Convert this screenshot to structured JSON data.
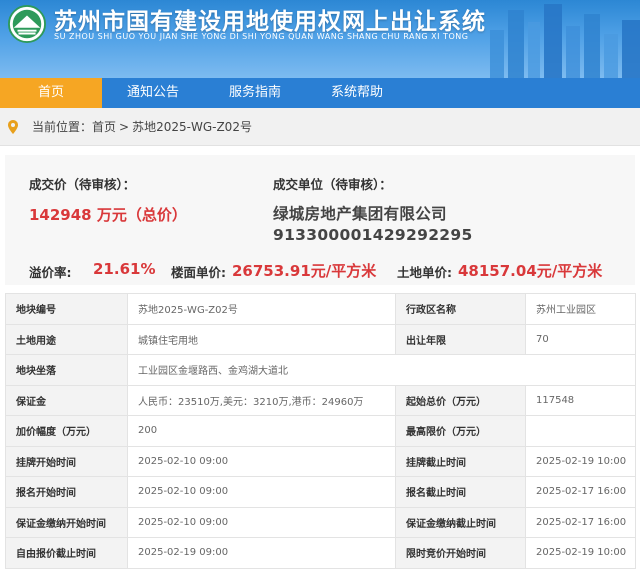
{
  "header": {
    "title": "苏州市国有建设用地使用权网上出让系统",
    "subtitle": "SU ZHOU SHI GUO YOU JIAN SHE YONG DI SHI YONG QUAN WANG SHANG CHU RANG XI TONG",
    "logo_icon": "land-emblem-icon"
  },
  "nav": {
    "items": [
      {
        "label": "首页",
        "active": true
      },
      {
        "label": "通知公告",
        "active": false
      },
      {
        "label": "服务指南",
        "active": false
      },
      {
        "label": "系统帮助",
        "active": false
      }
    ],
    "active_color": "#f6a623",
    "bar_color": "#2a7fd4"
  },
  "breadcrumb": {
    "icon": "location-pin-icon",
    "prefix": "当前位置：",
    "home": "首页",
    "separator": ">",
    "current": "苏地2025-WG-Z02号"
  },
  "summary": {
    "price_label": "成交价（待审核）：",
    "price_value": "142948 万元（总价）",
    "buyer_label": "成交单位（待审核）：",
    "buyer_name": "绿城房地产集团有限公司",
    "buyer_code": "913300001429292295",
    "premium_label": "溢价率:",
    "premium_value": "21.61%",
    "floor_price_label": "楼面单价:",
    "floor_price_value": "26753.91元/平方米",
    "land_price_label": "土地单价:",
    "land_price_value": "48157.04元/平方米",
    "highlight_color": "#d9383a"
  },
  "details": {
    "parcel_no_label": "地块编号",
    "parcel_no": "苏地2025-WG-Z02号",
    "district_label": "行政区名称",
    "district": "苏州工业园区",
    "usage_label": "土地用途",
    "usage": "城镇住宅用地",
    "term_label": "出让年限",
    "term": "70",
    "location_label": "地块坐落",
    "location": "工业园区金堰路西、金鸡湖大道北",
    "deposit_label": "保证金",
    "deposit": "人民币：23510万,美元：3210万,港币：24960万",
    "start_price_label": "起始总价（万元）",
    "start_price": "117548",
    "increment_label": "加价幅度（万元）",
    "increment": "200",
    "max_price_label": "最高限价（万元）",
    "max_price": "",
    "listing_start_label": "挂牌开始时间",
    "listing_start": "2025-02-10 09:00",
    "listing_end_label": "挂牌截止时间",
    "listing_end": "2025-02-19 10:00",
    "signup_start_label": "报名开始时间",
    "signup_start": "2025-02-10 09:00",
    "signup_end_label": "报名截止时间",
    "signup_end": "2025-02-17 16:00",
    "deposit_start_label": "保证金缴纳开始时间",
    "deposit_start": "2025-02-10 09:00",
    "deposit_end_label": "保证金缴纳截止时间",
    "deposit_end": "2025-02-17 16:00",
    "free_bid_end_label": "自由报价截止时间",
    "free_bid_end": "2025-02-19 09:00",
    "timed_bid_start_label": "限时竞价开始时间",
    "timed_bid_start": "2025-02-19 10:00"
  }
}
